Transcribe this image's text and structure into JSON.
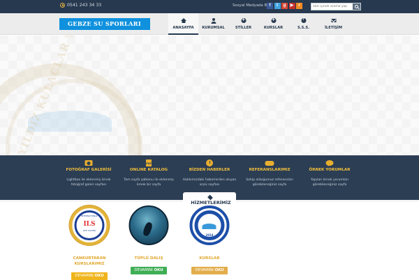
{
  "topbar": {
    "phone": "0541 243 34 33",
    "social_label": "Sosyal Medyada Biz",
    "social": [
      {
        "icon": "facebook-icon",
        "glyph": "f",
        "color": "#3b5998"
      },
      {
        "icon": "twitter-icon",
        "glyph": "t",
        "color": "#41a4df"
      },
      {
        "icon": "google-plus-icon",
        "glyph": "g",
        "color": "#d34836"
      },
      {
        "icon": "youtube-icon",
        "glyph": "▶",
        "color": "#c4302b"
      },
      {
        "icon": "rss-icon",
        "glyph": "r",
        "color": "#f28b24"
      }
    ],
    "search_placeholder": "Site içinde arama yap"
  },
  "header": {
    "logo": "GEBZE SU SPORLARI",
    "logo_color": "#0f91de",
    "nav": [
      {
        "label": "ANASAYFA",
        "icon": "home-icon",
        "active": true
      },
      {
        "label": "KURUMSAL",
        "icon": "user-icon"
      },
      {
        "label": "STİLLER",
        "icon": "plus-circle-icon"
      },
      {
        "label": "KURSLAR",
        "icon": "plus-circle-icon"
      },
      {
        "label": "S.S.S.",
        "icon": "question-circle-icon"
      },
      {
        "label": "İLETİŞİM",
        "icon": "envelope-icon"
      }
    ]
  },
  "slider": {
    "watermark_text": "YILDIZ KULAÇLAR YÜZME"
  },
  "features": [
    {
      "title": "FOTOĞRAF GALERİSİ",
      "desc": "Lightbox ile eklenmiş örnek fotoğraf galeri sayfası",
      "icon": "camera-icon"
    },
    {
      "title": "ONLINE KATALOG",
      "desc": "Tam sayfa şablonu ile eklenmiş örnek bir sayfa",
      "icon": "pdf-icon",
      "icon_text": "PDF"
    },
    {
      "title": "BİZDEN HABERLER",
      "desc": "Hakkımızdaki haberlerden oluşan arşiv sayfası",
      "icon": "newspaper-icon"
    },
    {
      "title": "REFERANSLARIMIZ",
      "desc": "Sahip olduğumuz referansları görebileceğiniz sayfa",
      "icon": "handshake-icon"
    },
    {
      "title": "ÖRNEK YORUMLAR",
      "desc": "Yapılan örnek yorumları görebileceğiniz sayfa",
      "icon": "comments-icon"
    }
  ],
  "services": {
    "heading": "HİZMETLERİMİZ",
    "items": [
      {
        "title": "CANKURTARAN KURSLARIMIZ",
        "btn_main": "DEVAMINI",
        "btn_bold": "OKU",
        "btn_color": "#f0b51c",
        "badge_top": "INTERNATIONAL",
        "badge_main": "ILS",
        "badge_bottom": "LIFE SAVING"
      },
      {
        "title": "TÜPLÜ DALIŞ",
        "btn_main": "DEVAMINI",
        "btn_bold": "OKU",
        "btn_color": "#3fae55"
      },
      {
        "title": "KURSLAR",
        "btn_main": "DEVAMINI",
        "btn_bold": "OKU",
        "btn_color": "#e3ad4b",
        "badge_year": "2014"
      }
    ]
  }
}
